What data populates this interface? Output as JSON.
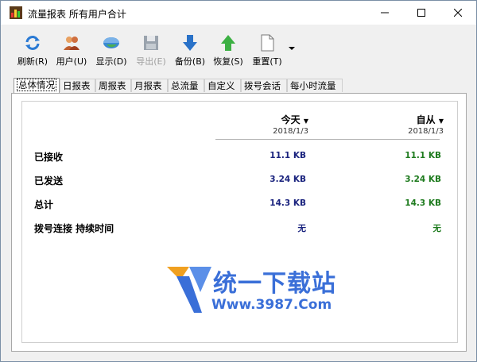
{
  "window": {
    "title": "流量报表 所有用户合计"
  },
  "toolbar": {
    "refresh": "刷新(R)",
    "users": "用户(U)",
    "display": "显示(D)",
    "export": "导出(E)",
    "backup": "备份(B)",
    "restore": "恢复(S)",
    "reset": "重置(T)"
  },
  "tabs": [
    {
      "label": "总体情况",
      "active": true
    },
    {
      "label": "日报表"
    },
    {
      "label": "周报表"
    },
    {
      "label": "月报表"
    },
    {
      "label": "总流量"
    },
    {
      "label": "自定义"
    },
    {
      "label": "拨号会话"
    },
    {
      "label": "每小时流量"
    }
  ],
  "summary": {
    "col_today": {
      "name": "今天",
      "date": "2018/1/3"
    },
    "col_since": {
      "name": "自从",
      "date": "2018/1/3"
    },
    "rows": [
      {
        "label": "已接收",
        "today": "11.1 KB",
        "since": "11.1 KB"
      },
      {
        "label": "已发送",
        "today": "3.24 KB",
        "since": "3.24 KB"
      },
      {
        "label": "总计",
        "today": "14.3 KB",
        "since": "14.3 KB"
      },
      {
        "label": "拨号连接 持续时间",
        "today": "无",
        "since": "无"
      }
    ]
  },
  "watermark": {
    "text": "统一下载站",
    "url": "Www.3987.Com"
  },
  "colors": {
    "today_value": "#1a237e",
    "since_value": "#1e7b1e",
    "watermark": "#3a6fd8"
  }
}
